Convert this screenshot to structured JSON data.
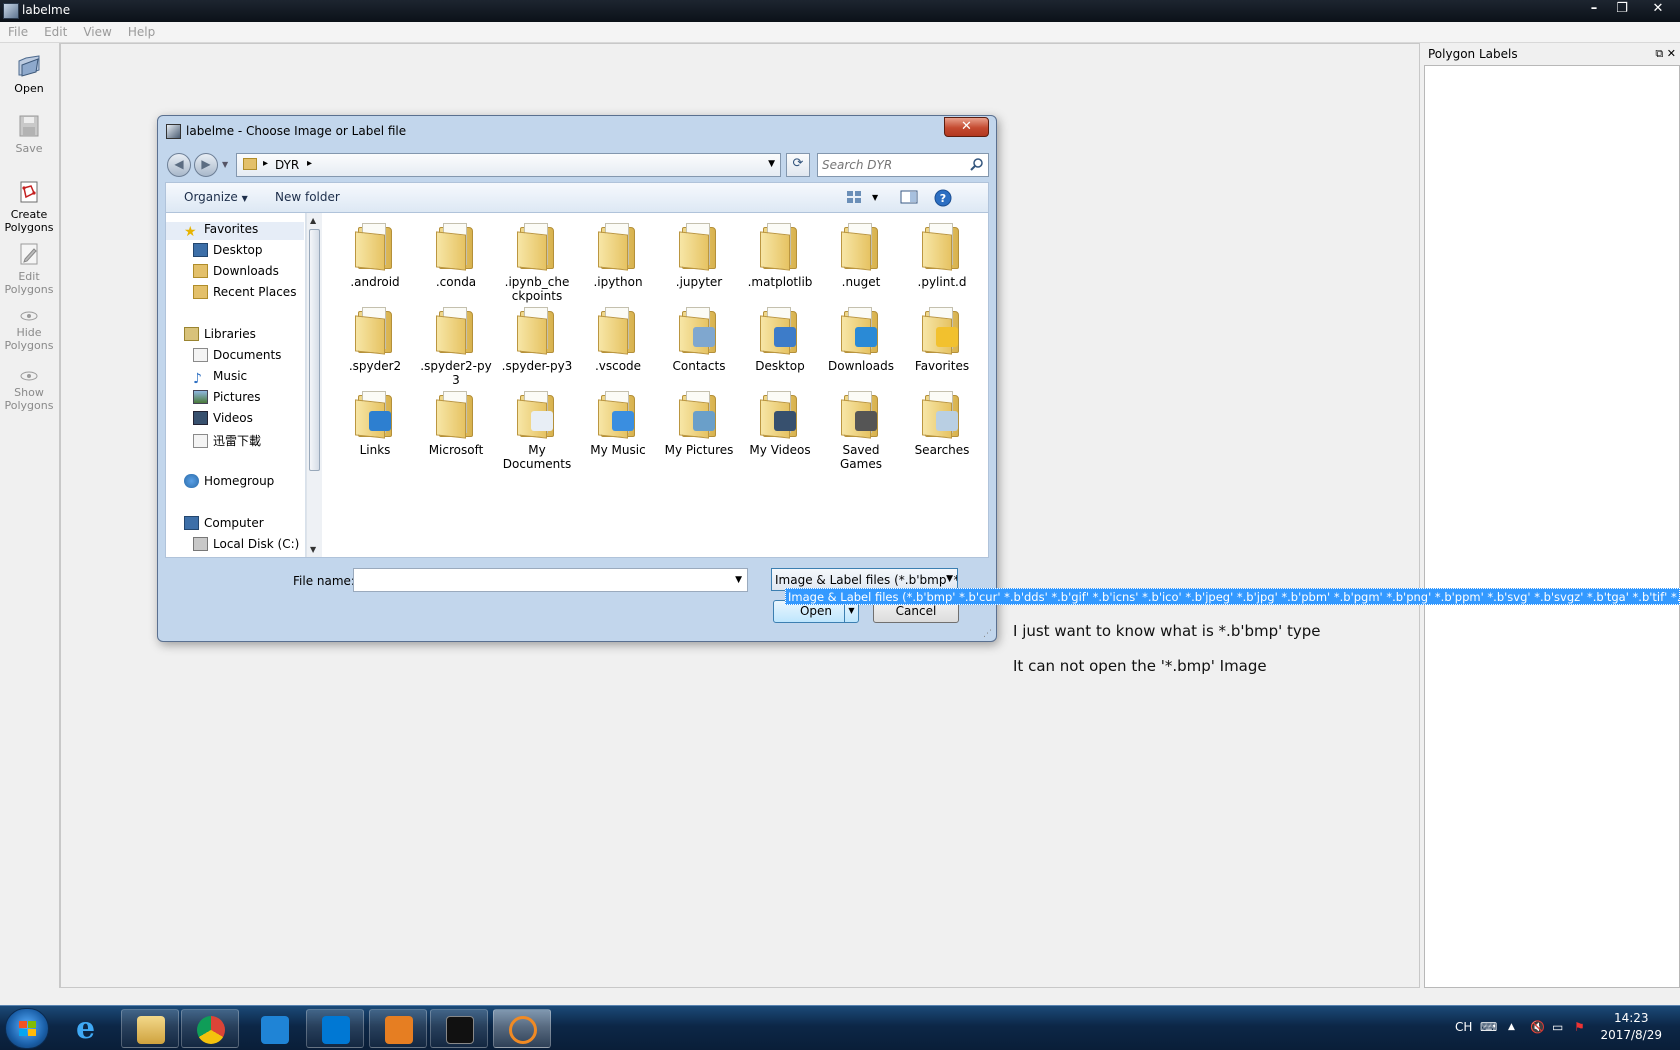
{
  "app": {
    "title": "labelme",
    "menu": [
      "File",
      "Edit",
      "View",
      "Help"
    ],
    "tools": [
      {
        "label1": "Open",
        "label2": ""
      },
      {
        "label1": "Save",
        "label2": ""
      },
      {
        "label1": "Create",
        "label2": "Polygons"
      },
      {
        "label1": "Edit",
        "label2": "Polygons"
      },
      {
        "label1": "Hide",
        "label2": "Polygons"
      },
      {
        "label1": "Show",
        "label2": "Polygons"
      }
    ],
    "dock_title": "Polygon Labels"
  },
  "annotations": {
    "line1": "I just want to know  what is *.b'bmp'  type",
    "line2": "It can not open the '*.bmp' Image"
  },
  "dialog": {
    "title": "labelme - Choose Image or Label file",
    "breadcrumb": "DYR",
    "search_placeholder": "Search DYR",
    "organize": "Organize",
    "new_folder": "New folder",
    "tree": {
      "favorites": "Favorites",
      "desktop": "Desktop",
      "downloads": "Downloads",
      "recent": "Recent Places",
      "libraries": "Libraries",
      "documents": "Documents",
      "music": "Music",
      "pictures": "Pictures",
      "videos": "Videos",
      "xunlei": "迅雷下載",
      "homegroup": "Homegroup",
      "computer": "Computer",
      "local_disk": "Local Disk (C:)"
    },
    "files": [
      {
        "l1": ".android",
        "l2": "",
        "badge": ""
      },
      {
        "l1": ".conda",
        "l2": "",
        "badge": ""
      },
      {
        "l1": ".ipynb_che",
        "l2": "ckpoints",
        "badge": ""
      },
      {
        "l1": ".ipython",
        "l2": "",
        "badge": ""
      },
      {
        "l1": ".jupyter",
        "l2": "",
        "badge": ""
      },
      {
        "l1": ".matplotlib",
        "l2": "",
        "badge": ""
      },
      {
        "l1": ".nuget",
        "l2": "",
        "badge": ""
      },
      {
        "l1": ".pylint.d",
        "l2": "",
        "badge": ""
      },
      {
        "l1": ".spyder2",
        "l2": "",
        "badge": ""
      },
      {
        "l1": ".spyder2-py",
        "l2": "3",
        "badge": ""
      },
      {
        "l1": ".spyder-py3",
        "l2": "",
        "badge": ""
      },
      {
        "l1": ".vscode",
        "l2": "",
        "badge": ""
      },
      {
        "l1": "Contacts",
        "l2": "",
        "badge": "#7fa7cf"
      },
      {
        "l1": "Desktop",
        "l2": "",
        "badge": "#3d7cc9"
      },
      {
        "l1": "Downloads",
        "l2": "",
        "badge": "#2a8ad6"
      },
      {
        "l1": "Favorites",
        "l2": "",
        "badge": "#f2c12e"
      },
      {
        "l1": "Links",
        "l2": "",
        "badge": "#2d7fd0"
      },
      {
        "l1": "Microsoft",
        "l2": "",
        "badge": ""
      },
      {
        "l1": "My",
        "l2": "Documents",
        "badge": "#e8eef5"
      },
      {
        "l1": "My Music",
        "l2": "",
        "badge": "#3a8ee0"
      },
      {
        "l1": "My Pictures",
        "l2": "",
        "badge": "#6a9fc9"
      },
      {
        "l1": "My Videos",
        "l2": "",
        "badge": "#37506e"
      },
      {
        "l1": "Saved",
        "l2": "Games",
        "badge": "#555555"
      },
      {
        "l1": "Searches",
        "l2": "",
        "badge": "#b9cfe3"
      }
    ],
    "file_name_label": "File name:",
    "file_name_value": "",
    "filter_value": "Image & Label files (*.b'bmp' *.",
    "filter_popup": "Image & Label files (*.b'bmp' *.b'cur' *.b'dds' *.b'gif' *.b'icns' *.b'ico' *.b'jpeg' *.b'jpg' *.b'pbm' *.b'pgm' *.b'png' *.b'ppm' *.b'svg' *.b'svgz' *.b'tga' *.b'tif' *.b'tiff' *.b'wbm",
    "open_btn": "Open",
    "cancel_btn": "Cancel"
  },
  "taskbar": {
    "lang": "CH",
    "time": "14:23",
    "date": "2017/8/29"
  }
}
